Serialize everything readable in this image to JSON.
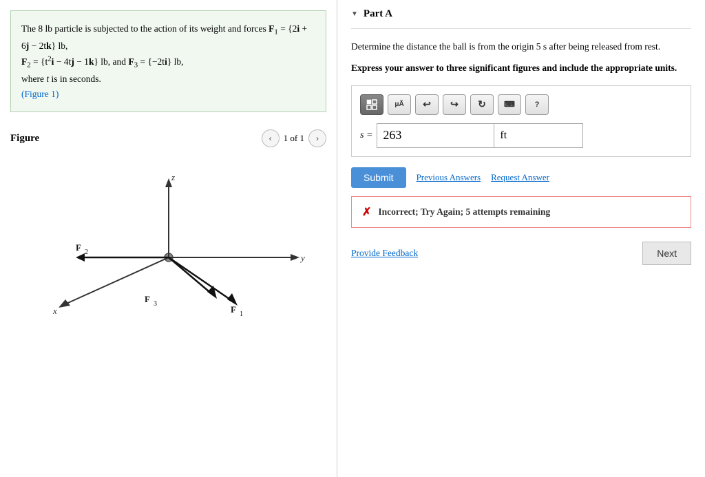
{
  "left": {
    "problem": {
      "intro": "The 8  lb particle is subjected to the action of its weight and forces",
      "F1_label": "F₁ = {2i + 6j − 2tk} lb,",
      "F2_label": "F₂ = {t²i − 4tj − 1k} lb, and F₃ = {−2ti} lb,",
      "time_note": "where t is in seconds.",
      "figure_link": "(Figure 1)"
    },
    "figure": {
      "title": "Figure",
      "page": "1 of 1",
      "prev_label": "‹",
      "next_label": "›"
    }
  },
  "right": {
    "part": {
      "collapse_icon": "▼",
      "title": "Part A"
    },
    "question": "Determine the distance the ball is from the origin 5  s after being released from rest.",
    "instruction": "Express your answer to three significant figures and include the appropriate units.",
    "toolbar": {
      "matrix_btn": "⊞",
      "mu_btn": "μÃ",
      "undo_btn": "↩",
      "redo_btn": "↪",
      "refresh_btn": "↻",
      "keyboard_btn": "⌨",
      "help_btn": "?"
    },
    "answer": {
      "variable_label": "s =",
      "value": "263",
      "unit": "ft"
    },
    "buttons": {
      "submit": "Submit",
      "previous_answers": "Previous Answers",
      "request_answer": "Request Answer"
    },
    "feedback": {
      "icon": "✗",
      "message": "Incorrect; Try Again; 5 attempts remaining"
    },
    "provide_feedback_label": "Provide Feedback",
    "next_label": "Next"
  }
}
